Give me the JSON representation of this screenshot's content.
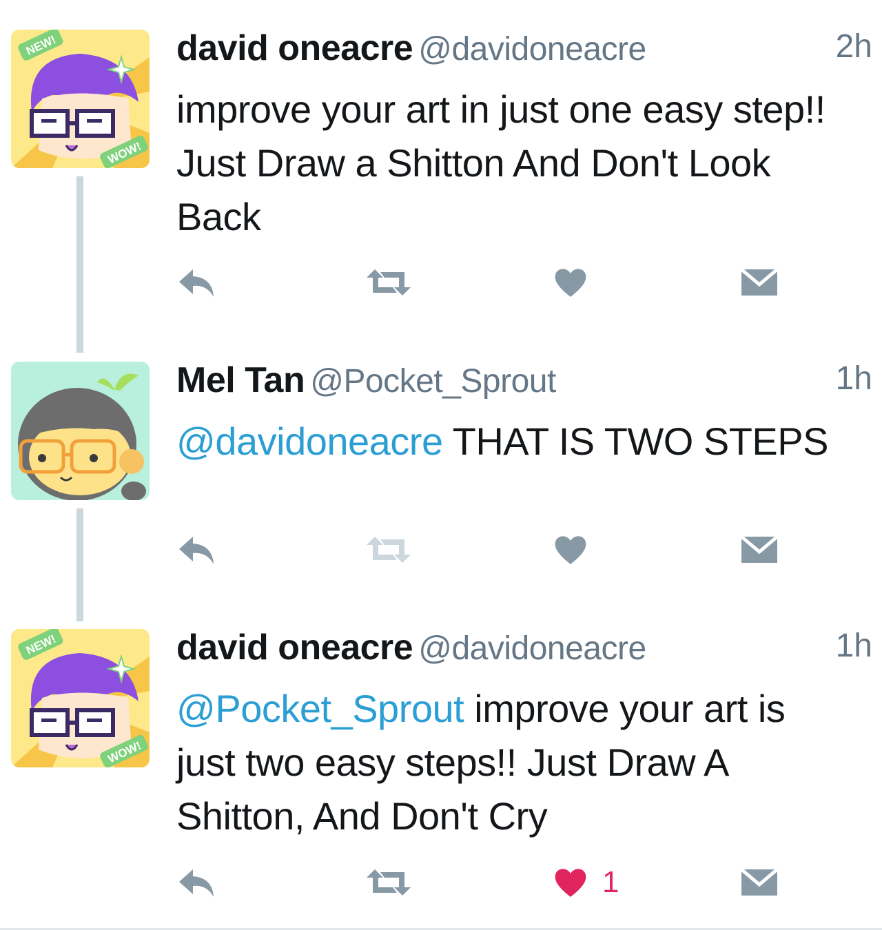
{
  "tweets": [
    {
      "display_name": "david oneacre",
      "handle": "@davidoneacre",
      "time": "2h",
      "avatar_icon": "avatar-purple-hair-glasses",
      "avatar_badges": [
        "NEW!",
        "WOW!"
      ],
      "text_lines": [
        "improve your art in just one easy step!!",
        "Just Draw a Shitton And Don't Look",
        "Back"
      ],
      "like_count": "",
      "liked": false
    },
    {
      "display_name": "Mel Tan",
      "handle": "@Pocket_Sprout",
      "time": "1h",
      "avatar_icon": "avatar-sprout-glasses",
      "mention": "@davidoneacre",
      "text": "THAT IS TWO STEPS",
      "like_count": "",
      "liked": false
    },
    {
      "display_name": "david oneacre",
      "handle": "@davidoneacre",
      "time": "1h",
      "avatar_icon": "avatar-purple-hair-glasses",
      "avatar_badges": [
        "NEW!",
        "WOW!"
      ],
      "mention": "@Pocket_Sprout",
      "text_line1_rest": "improve your art is",
      "text_lines": [
        "just two easy steps!! Just Draw A",
        "Shitton, And Don't Cry"
      ],
      "like_count": "1",
      "liked": true
    }
  ],
  "icons": {
    "reply": "reply-icon",
    "retweet": "retweet-icon",
    "like": "heart-icon",
    "dm": "envelope-icon"
  },
  "colors": {
    "text": "#14171a",
    "secondary": "#657786",
    "mention": "#2b9ed4",
    "action_gray": "#8899a6",
    "liked_red": "#e0245e",
    "thread_line": "#ccd6dd"
  }
}
